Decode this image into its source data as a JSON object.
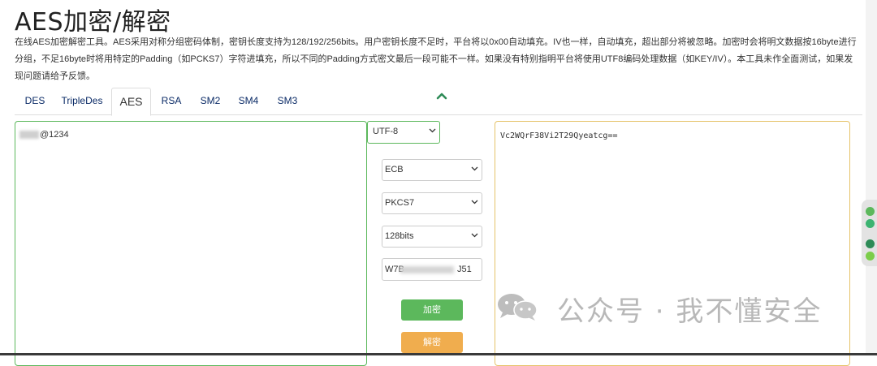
{
  "page": {
    "title": "AES加密/解密",
    "description": "在线AES加密解密工具。AES采用对称分组密码体制，密钥长度支持为128/192/256bits。用户密钥长度不足时，平台将以0x00自动填充。IV也一样，自动填充，超出部分将被忽略。加密时会将明文数据按16byte进行分组，不足16byte时将用特定的Padding（如PCKS7）字符进填充，所以不同的Padding方式密文最后一段可能不一样。如果没有特别指明平台将使用UTF8编码处理数据（如KEY/IV）。本工具未作全面测试，如果发现问题请给予反馈。"
  },
  "tabs": [
    "DES",
    "TripleDes",
    "AES",
    "RSA",
    "SM2",
    "SM4",
    "SM3"
  ],
  "active_tab": "AES",
  "input": {
    "plaintext_visible": "@1234",
    "encoding": "UTF-8"
  },
  "options": {
    "mode": "ECB",
    "padding": "PKCS7",
    "key_length": "128bits",
    "key_start": "W7B",
    "key_end": "J51"
  },
  "buttons": {
    "encrypt": "加密",
    "decrypt": "解密"
  },
  "output": {
    "ciphertext": "Vc2WQrF38Vi2T29Qyeatcg=="
  },
  "watermark": {
    "text": "公众号 · 我不懂安全"
  },
  "colors": {
    "green": "#5cb85c",
    "orange": "#f0ad4e",
    "output_border": "#e6c36a"
  }
}
